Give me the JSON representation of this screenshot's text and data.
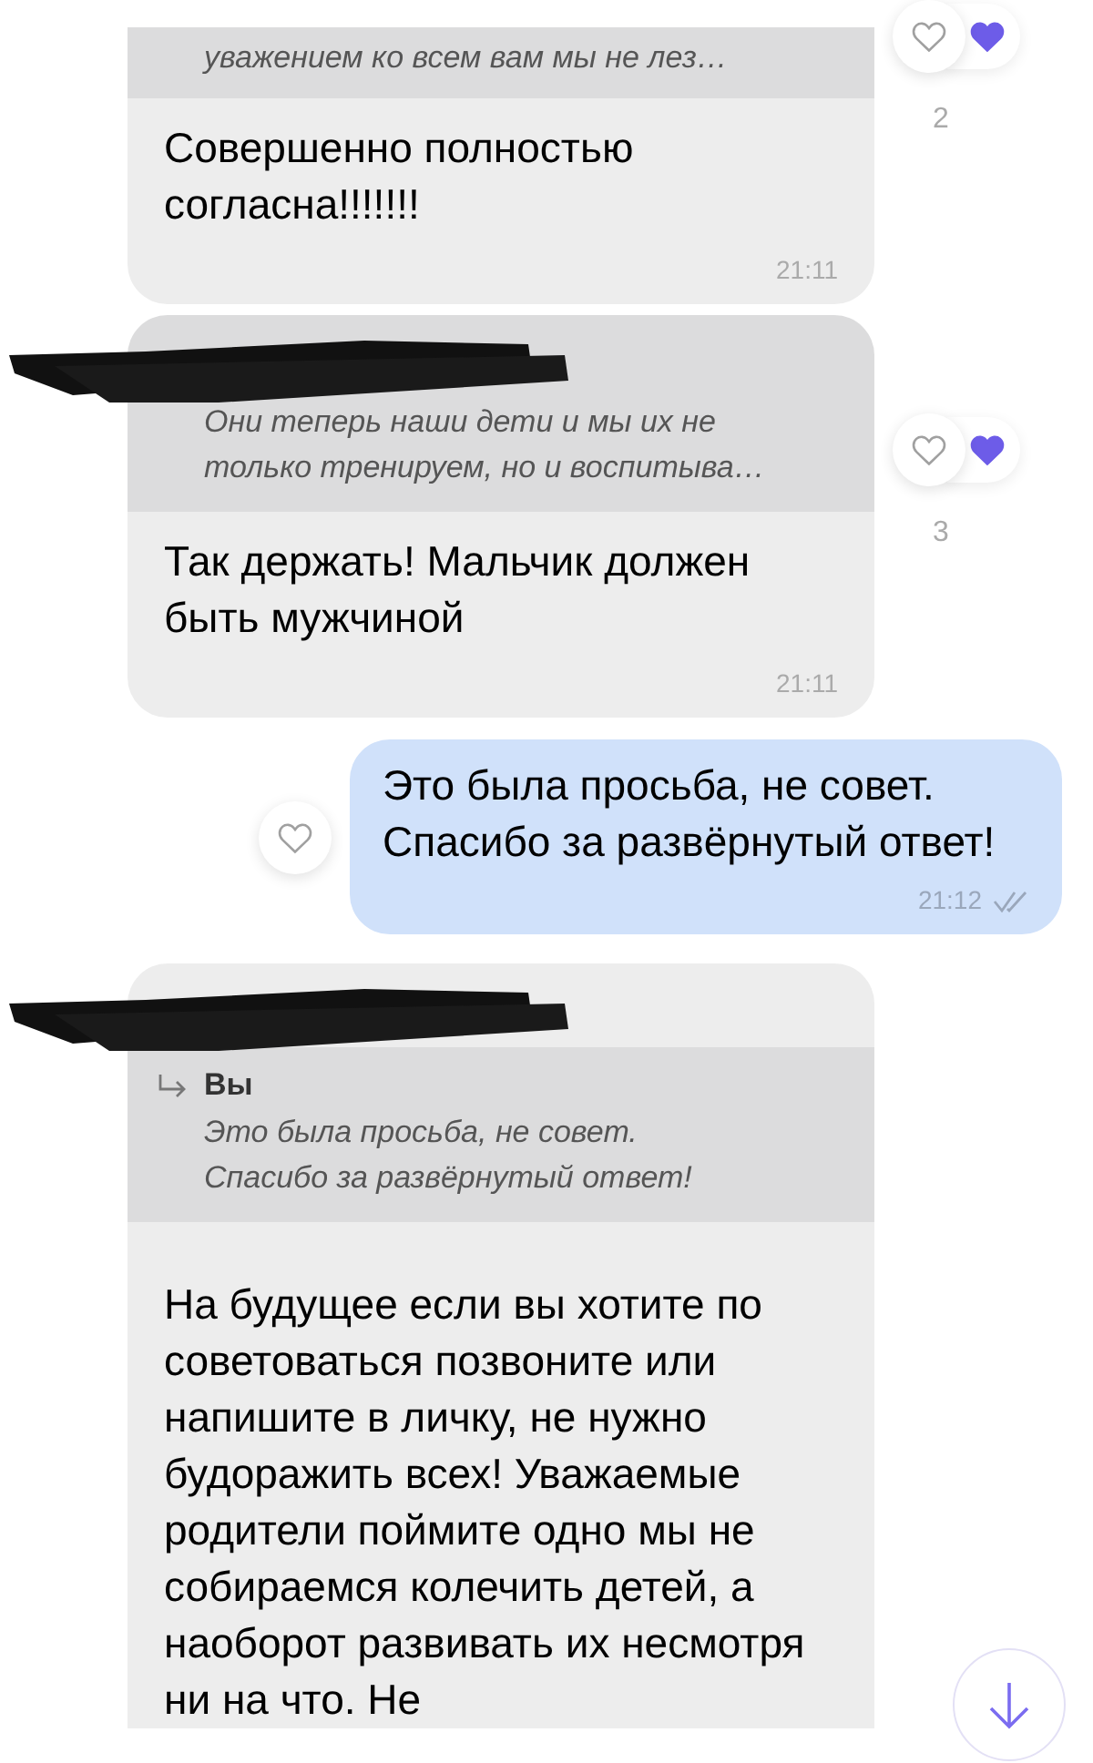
{
  "messages": [
    {
      "kind": "received",
      "quote": {
        "lines": [
          "уважением ко всем вам мы не лез…"
        ]
      },
      "text": "Совершенно полностью согласна!!!!!!!",
      "time": "21:11",
      "reaction": {
        "liked": false,
        "count": "2"
      }
    },
    {
      "kind": "received",
      "sender_hidden": true,
      "quote": {
        "lines": [
          "Они теперь наши дети и мы их не",
          "только тренируем, но и воспитыва…"
        ]
      },
      "text": "Так держать! Мальчик должен быть мужчиной",
      "time": "21:11",
      "reaction": {
        "liked": false,
        "count": "3"
      }
    },
    {
      "kind": "sent",
      "text": "Это была просьба, не совет. Спасибо за развёрнутый ответ!",
      "time": "21:12",
      "read": true,
      "reaction": {
        "liked": false
      }
    },
    {
      "kind": "received",
      "sender_hidden": true,
      "quote": {
        "author": "Вы",
        "lines": [
          "Это была просьба, не совет.",
          "Спасибо за развёрнутый ответ!"
        ]
      },
      "text": "На будущее если вы хотите по советоваться позвоните или напишите в личку, не нужно будоражить всех! Уважаемые родители поймите одно мы не собираемся колечить детей, а наоборот развивать их несмотря ни на что. Не"
    }
  ]
}
